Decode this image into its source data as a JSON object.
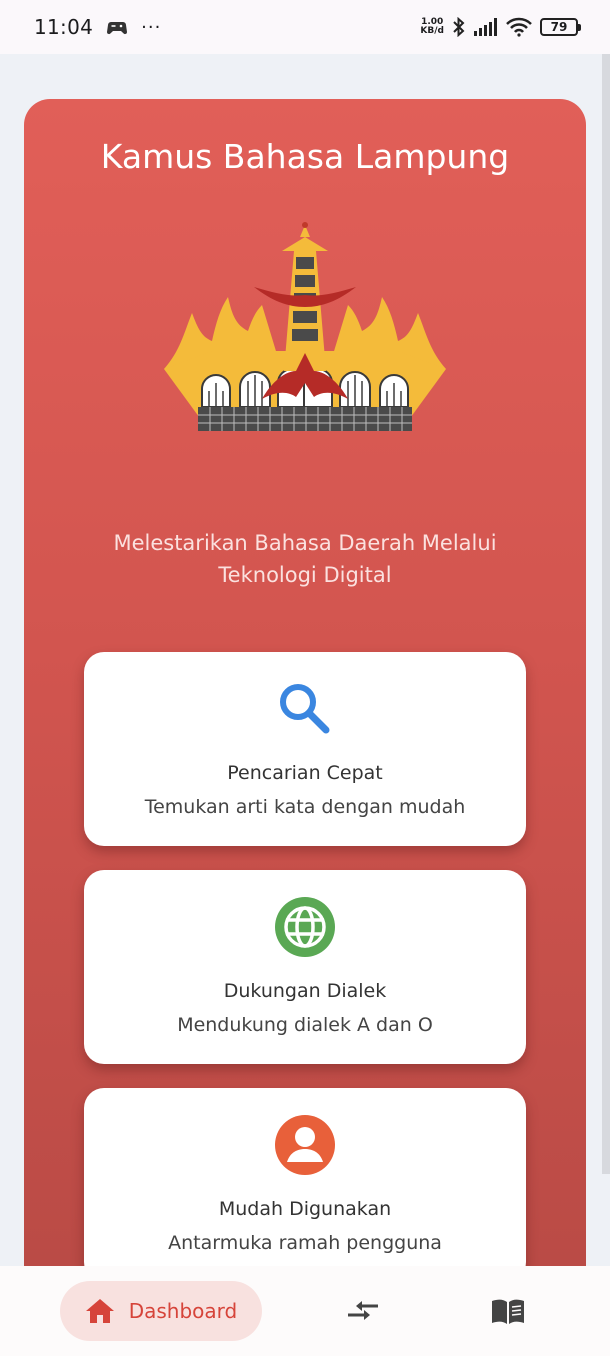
{
  "status_bar": {
    "time": "11:04",
    "more": "···",
    "net_speed_value": "1.00",
    "net_speed_unit": "KB/d",
    "battery": "79"
  },
  "hero": {
    "title": "Kamus Bahasa Lampung",
    "subtitle_line1": "Melestarikan Bahasa Daerah Melalui",
    "subtitle_line2": "Teknologi Digital",
    "logo_icon": "lampung-siger-logo"
  },
  "features": [
    {
      "icon": "search-icon",
      "color": "#3a86e0",
      "title": "Pencarian Cepat",
      "description": "Temukan arti kata dengan mudah"
    },
    {
      "icon": "globe-icon",
      "color": "#5aa854",
      "title": "Dukungan Dialek",
      "description": "Mendukung dialek A dan O"
    },
    {
      "icon": "person-icon",
      "color": "#e8603a",
      "title": "Mudah Digunakan",
      "description": "Antarmuka ramah pengguna"
    }
  ],
  "bottom_nav": {
    "items": [
      {
        "label": "Dashboard",
        "icon": "home-icon",
        "active": true
      },
      {
        "label": "",
        "icon": "swap-arrows-icon",
        "active": false
      },
      {
        "label": "",
        "icon": "book-icon",
        "active": false
      }
    ],
    "accent": "#d6443a"
  }
}
